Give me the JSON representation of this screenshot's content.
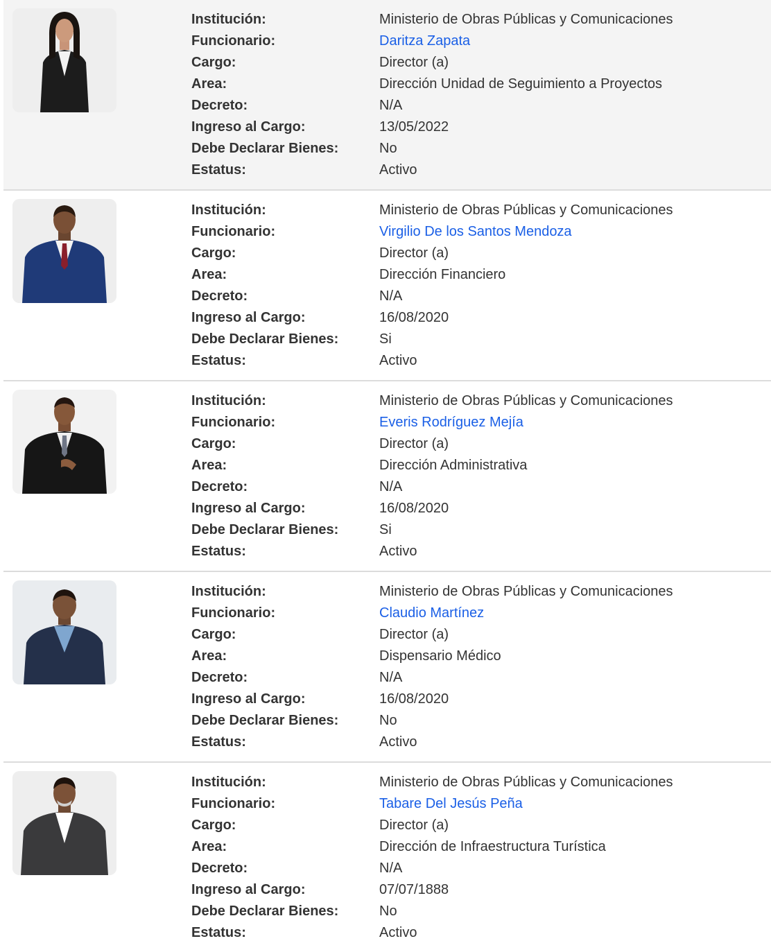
{
  "labels": {
    "institucion": "Institución:",
    "funcionario": "Funcionario:",
    "cargo": "Cargo:",
    "area": "Area:",
    "decreto": "Decreto:",
    "ingreso": "Ingreso al Cargo:",
    "declarar": "Debe Declarar Bienes:",
    "estatus": "Estatus:"
  },
  "colors": {
    "link": "#1a5fe6",
    "row_highlight": "#f4f4f4"
  },
  "officials": [
    {
      "institucion": "Ministerio de Obras Públicas y Comunicaciones",
      "funcionario": "Daritza Zapata",
      "cargo": "Director (a)",
      "area": "Dirección Unidad de Seguimiento a Proyectos",
      "decreto": "N/A",
      "ingreso": "13/05/2022",
      "declarar": "No",
      "estatus": "Activo"
    },
    {
      "institucion": "Ministerio de Obras Públicas y Comunicaciones",
      "funcionario": "Virgilio De los Santos Mendoza",
      "cargo": "Director (a)",
      "area": "Dirección Financiero",
      "decreto": "N/A",
      "ingreso": "16/08/2020",
      "declarar": "Si",
      "estatus": "Activo"
    },
    {
      "institucion": "Ministerio de Obras Públicas y Comunicaciones",
      "funcionario": "Everis Rodríguez Mejía",
      "cargo": "Director (a)",
      "area": "Dirección Administrativa",
      "decreto": "N/A",
      "ingreso": "16/08/2020",
      "declarar": "Si",
      "estatus": "Activo"
    },
    {
      "institucion": "Ministerio de Obras Públicas y Comunicaciones",
      "funcionario": "Claudio Martínez",
      "cargo": "Director (a)",
      "area": "Dispensario Médico",
      "decreto": "N/A",
      "ingreso": "16/08/2020",
      "declarar": "No",
      "estatus": "Activo"
    },
    {
      "institucion": "Ministerio de Obras Públicas y Comunicaciones",
      "funcionario": "Tabare Del Jesús Peña",
      "cargo": "Director (a)",
      "area": "Dirección de Infraestructura Turística",
      "decreto": "N/A",
      "ingreso": "07/07/1888",
      "declarar": "No",
      "estatus": "Activo"
    }
  ]
}
